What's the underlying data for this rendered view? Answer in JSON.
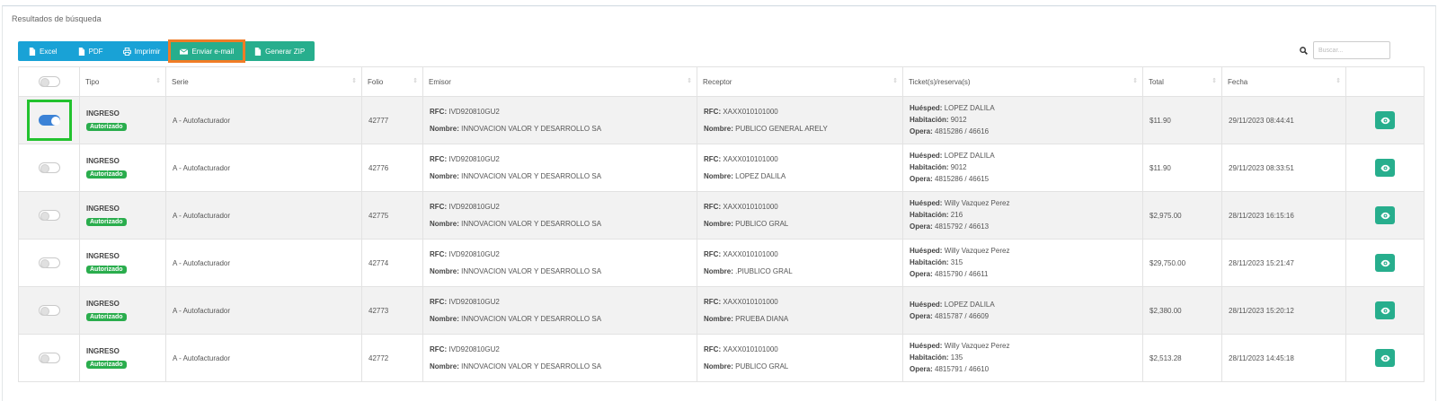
{
  "panel": {
    "title": "Resultados de búsqueda"
  },
  "toolbar": {
    "excel": "Excel",
    "pdf": "PDF",
    "print": "Imprimir",
    "email": "Enviar e-mail",
    "zip": "Generar ZIP"
  },
  "search": {
    "placeholder": "Buscar..."
  },
  "columns": [
    "Tipo",
    "Serie",
    "Folio",
    "Emisor",
    "Receptor",
    "Ticket(s)/reserva(s)",
    "Total",
    "Fecha"
  ],
  "labels": {
    "rfc": "RFC:",
    "nombre": "Nombre:",
    "huesped": "Huésped:",
    "habitacion": "Habitación:",
    "opera": "Opera:"
  },
  "rows": [
    {
      "selected": true,
      "tipo": "INGRESO",
      "status": "Autorizado",
      "serie": "A - Autofacturador",
      "folio": "42777",
      "emisor_rfc": "IVD920810GU2",
      "emisor_nombre": "INNOVACION VALOR Y DESARROLLO SA",
      "receptor_rfc": "XAXX010101000",
      "receptor_nombre": "PUBLICO GENERAL ARELY",
      "huesped": "LOPEZ DALILA",
      "habitacion": "9012",
      "opera": "4815286 / 46616",
      "total": "$11.90",
      "fecha": "29/11/2023 08:44:41"
    },
    {
      "selected": false,
      "tipo": "INGRESO",
      "status": "Autorizado",
      "serie": "A - Autofacturador",
      "folio": "42776",
      "emisor_rfc": "IVD920810GU2",
      "emisor_nombre": "INNOVACION VALOR Y DESARROLLO SA",
      "receptor_rfc": "XAXX010101000",
      "receptor_nombre": "LOPEZ DALILA",
      "huesped": "LOPEZ DALILA",
      "habitacion": "9012",
      "opera": "4815286 / 46615",
      "total": "$11.90",
      "fecha": "29/11/2023 08:33:51"
    },
    {
      "selected": false,
      "tipo": "INGRESO",
      "status": "Autorizado",
      "serie": "A - Autofacturador",
      "folio": "42775",
      "emisor_rfc": "IVD920810GU2",
      "emisor_nombre": "INNOVACION VALOR Y DESARROLLO SA",
      "receptor_rfc": "XAXX010101000",
      "receptor_nombre": "PUBLICO GRAL",
      "huesped": "Willy Vazquez Perez",
      "habitacion": "216",
      "opera": "4815792 / 46613",
      "total": "$2,975.00",
      "fecha": "28/11/2023 16:15:16"
    },
    {
      "selected": false,
      "tipo": "INGRESO",
      "status": "Autorizado",
      "serie": "A - Autofacturador",
      "folio": "42774",
      "emisor_rfc": "IVD920810GU2",
      "emisor_nombre": "INNOVACION VALOR Y DESARROLLO SA",
      "receptor_rfc": "XAXX010101000",
      "receptor_nombre": ".PIUBLICO GRAL",
      "huesped": "Willy Vazquez Perez",
      "habitacion": "315",
      "opera": "4815790 / 46611",
      "total": "$29,750.00",
      "fecha": "28/11/2023 15:21:47"
    },
    {
      "selected": false,
      "tipo": "INGRESO",
      "status": "Autorizado",
      "serie": "A - Autofacturador",
      "folio": "42773",
      "emisor_rfc": "IVD920810GU2",
      "emisor_nombre": "INNOVACION VALOR Y DESARROLLO SA",
      "receptor_rfc": "XAXX010101000",
      "receptor_nombre": "PRUEBA DIANA",
      "huesped": "LOPEZ DALILA",
      "habitacion": null,
      "opera": "4815787 / 46609",
      "total": "$2,380.00",
      "fecha": "28/11/2023 15:20:12"
    },
    {
      "selected": false,
      "tipo": "INGRESO",
      "status": "Autorizado",
      "serie": "A - Autofacturador",
      "folio": "42772",
      "emisor_rfc": "IVD920810GU2",
      "emisor_nombre": "INNOVACION VALOR Y DESARROLLO SA",
      "receptor_rfc": "XAXX010101000",
      "receptor_nombre": "PUBLICO GRAL",
      "huesped": "Willy Vazquez Perez",
      "habitacion": "135",
      "opera": "4815791 / 46610",
      "total": "$2,513.28",
      "fecha": "28/11/2023 14:45:18"
    }
  ],
  "colors": {
    "blue": "#19a2d6",
    "green": "#27ae8d",
    "badge": "#2aad4d",
    "highlight_orange": "#f07c26",
    "highlight_green": "#22c22e",
    "toggle_on": "#3b82d6"
  }
}
